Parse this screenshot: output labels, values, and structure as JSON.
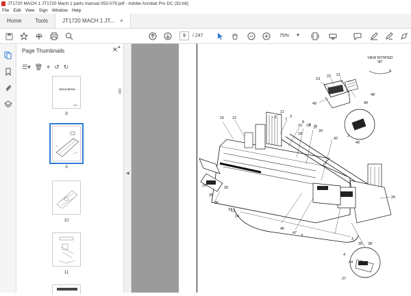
{
  "window": {
    "title": "JT1720 MACH 1 JT1720 Mach 1 parts manual 053-079.pdf - Adobe Acrobat Pro DC (32-bit)"
  },
  "menubar": {
    "items": [
      "File",
      "Edit",
      "View",
      "Sign",
      "Window",
      "Help"
    ]
  },
  "tabs": {
    "home": "Home",
    "tools": "Tools",
    "document": "JT1720 MACH 1 JT...",
    "close_glyph": "×"
  },
  "toolbar": {
    "current_page": "9",
    "total_pages": "/ 247",
    "zoom": "75%"
  },
  "panel": {
    "title": "Page Thumbnails",
    "close_glyph": "✕",
    "thumbnails": [
      {
        "label": "8"
      },
      {
        "label": "9"
      },
      {
        "label": "10"
      },
      {
        "label": "11"
      }
    ]
  },
  "diagram": {
    "view_label": "VIEW ROTATED 90°",
    "callouts": [
      "23",
      "22",
      "21",
      "48",
      "49",
      "40",
      "11",
      "7",
      "10",
      "6",
      "9",
      "18",
      "2",
      "8",
      "40",
      "42",
      "19",
      "17",
      "20",
      "16",
      "1",
      "3",
      "12",
      "15",
      "35",
      "30",
      "36",
      "33",
      "14",
      "46",
      "47",
      "3",
      "26",
      "3",
      "38",
      "35",
      "4",
      "44",
      "27",
      "13"
    ]
  },
  "colors": {
    "accent": "#2d7bd6",
    "doc_background": "#9b9b9b",
    "acrobat_red": "#d4322a"
  }
}
